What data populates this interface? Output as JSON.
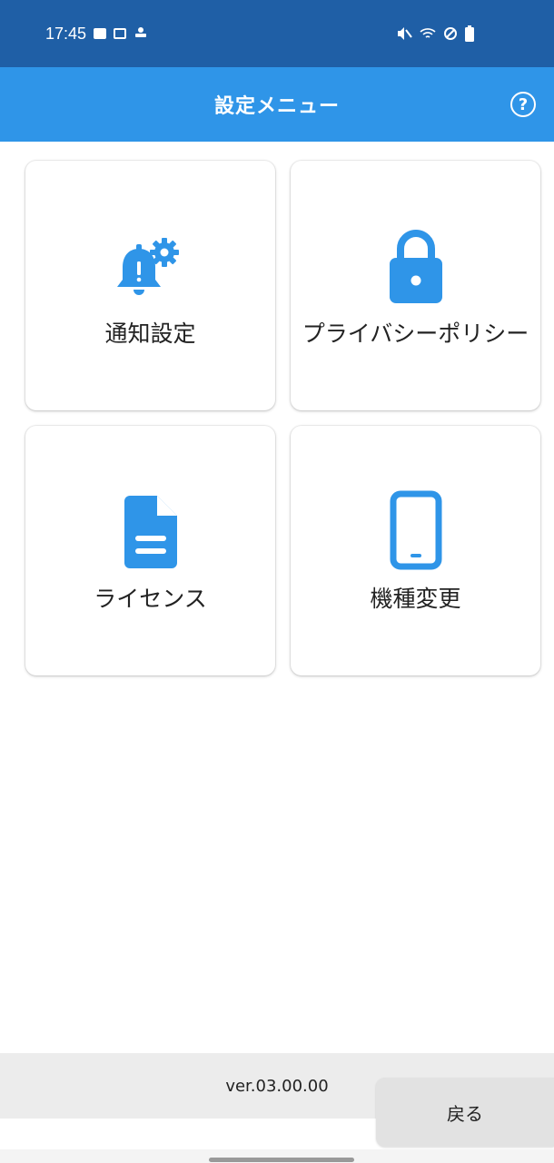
{
  "status_bar": {
    "time": "17:45",
    "icons_left": [
      "image-icon",
      "screen-icon",
      "account-icon"
    ],
    "icons_right": [
      "mute-icon",
      "wifi-icon",
      "dnd-icon",
      "battery-icon"
    ]
  },
  "app_bar": {
    "title": "設定メニュー",
    "help_icon": "help-icon",
    "help_glyph": "?"
  },
  "menu": {
    "items": [
      {
        "label": "通知設定",
        "icon": "notification-settings-icon"
      },
      {
        "label": "プライバシーポリシー",
        "icon": "lock-icon"
      },
      {
        "label": "ライセンス",
        "icon": "document-icon"
      },
      {
        "label": "機種変更",
        "icon": "smartphone-icon"
      }
    ]
  },
  "footer": {
    "version": "ver.03.00.00",
    "back_label": "戻る"
  },
  "colors": {
    "status_bar": "#1f5fa6",
    "app_bar": "#2f95e8",
    "icon": "#2f95e8",
    "version_bar": "#ececec",
    "back_button": "#e2e2e2"
  }
}
